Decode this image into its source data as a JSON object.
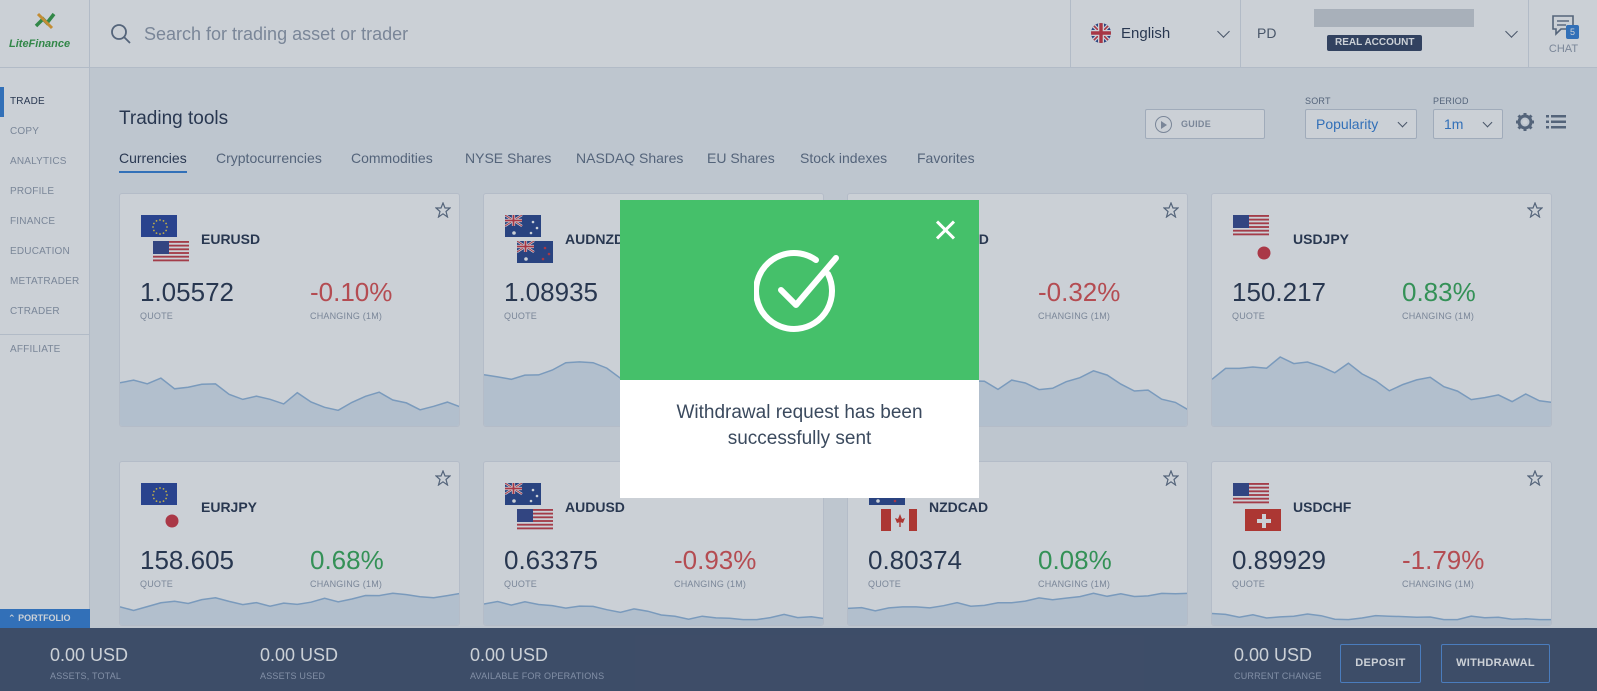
{
  "brand": {
    "name": "LiteFinance"
  },
  "search": {
    "placeholder": "Search for trading asset or trader"
  },
  "language": {
    "label": "English"
  },
  "account": {
    "initials": "PD",
    "type_badge": "REAL ACCOUNT"
  },
  "chat": {
    "label": "CHAT",
    "count": "5"
  },
  "sidebar": {
    "items": [
      {
        "label": "TRADE"
      },
      {
        "label": "COPY"
      },
      {
        "label": "ANALYTICS"
      },
      {
        "label": "PROFILE"
      },
      {
        "label": "FINANCE"
      },
      {
        "label": "EDUCATION"
      },
      {
        "label": "METATRADER"
      },
      {
        "label": "CTRADER"
      },
      {
        "label": "AFFILIATE"
      }
    ],
    "portfolio_label": "PORTFOLIO"
  },
  "main": {
    "title": "Trading tools",
    "guide_label": "GUIDE",
    "sort": {
      "label": "SORT",
      "value": "Popularity"
    },
    "period": {
      "label": "PERIOD",
      "value": "1m"
    },
    "tabs": [
      {
        "label": "Currencies"
      },
      {
        "label": "Cryptocurrencies"
      },
      {
        "label": "Commodities"
      },
      {
        "label": "NYSE Shares"
      },
      {
        "label": "NASDAQ Shares"
      },
      {
        "label": "EU Shares"
      },
      {
        "label": "Stock indexes"
      },
      {
        "label": "Favorites"
      }
    ],
    "quote_label": "QUOTE",
    "change_label": "CHANGING (1M)"
  },
  "cards": [
    {
      "symbol": "EURUSD",
      "quote": "1.05572",
      "change": "-0.10%",
      "trend": "negative",
      "flags": [
        "eu-flag",
        "us-flag"
      ]
    },
    {
      "symbol": "AUDNZD",
      "quote": "1.08935",
      "change": "",
      "trend": "negative",
      "flags": [
        "au-flag",
        "nz-flag"
      ]
    },
    {
      "symbol": "USDCAD",
      "quote": "",
      "change": "-0.32%",
      "trend": "negative",
      "flags": [
        "us-flag",
        "ca-flag"
      ]
    },
    {
      "symbol": "USDJPY",
      "quote": "150.217",
      "change": "0.83%",
      "trend": "positive",
      "flags": [
        "us-flag",
        "jp-flag"
      ]
    },
    {
      "symbol": "EURJPY",
      "quote": "158.605",
      "change": "0.68%",
      "trend": "positive",
      "flags": [
        "eu-flag",
        "jp-flag"
      ]
    },
    {
      "symbol": "AUDUSD",
      "quote": "0.63375",
      "change": "-0.93%",
      "trend": "negative",
      "flags": [
        "au-flag",
        "us-flag"
      ]
    },
    {
      "symbol": "NZDCAD",
      "quote": "0.80374",
      "change": "0.08%",
      "trend": "positive",
      "flags": [
        "nz-flag",
        "ca-flag"
      ]
    },
    {
      "symbol": "USDCHF",
      "quote": "0.89929",
      "change": "-1.79%",
      "trend": "negative",
      "flags": [
        "us-flag",
        "ch-flag"
      ]
    }
  ],
  "footer": {
    "assets_total": {
      "value": "0.00 USD",
      "label": "ASSETS, TOTAL"
    },
    "assets_used": {
      "value": "0.00 USD",
      "label": "ASSETS USED"
    },
    "available": {
      "value": "0.00 USD",
      "label": "AVAILABLE FOR OPERATIONS"
    },
    "current_change": {
      "value": "0.00 USD",
      "label": "CURRENT CHANGE"
    },
    "deposit_label": "DEPOSIT",
    "withdrawal_label": "WITHDRAWAL"
  },
  "modal": {
    "message": "Withdrawal request has been successfully sent",
    "icon": "check-circle-icon"
  },
  "colors": {
    "accent": "#2c7ad6",
    "positive": "#2fa84f",
    "negative": "#e04848",
    "modal_header": "#45c06a",
    "footer_bg": "#3b4a67"
  }
}
